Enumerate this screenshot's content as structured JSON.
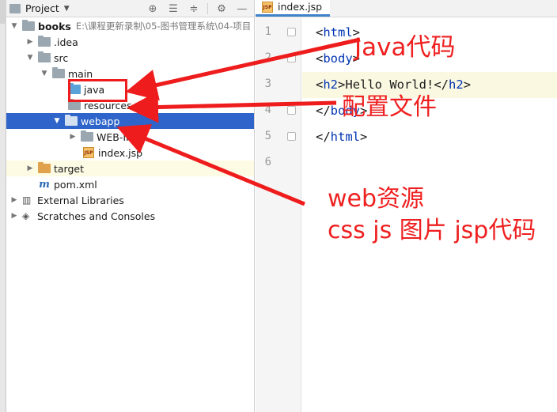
{
  "panel": {
    "title": "Project",
    "header_icons": [
      "target-icon",
      "collapse-all-icon",
      "expand-icon",
      "gear-icon",
      "minimize-icon"
    ]
  },
  "tree": [
    {
      "label": "books",
      "hint": "E:\\课程更新录制\\05-图书管理系统\\04-项目"
    },
    {
      "label": ".idea"
    },
    {
      "label": "src"
    },
    {
      "label": "main"
    },
    {
      "label": "java"
    },
    {
      "label": "resources"
    },
    {
      "label": "webapp"
    },
    {
      "label": "WEB-INF"
    },
    {
      "label": "index.jsp"
    },
    {
      "label": "target"
    },
    {
      "label": "pom.xml"
    },
    {
      "label": "External Libraries"
    },
    {
      "label": "Scratches and Consoles"
    }
  ],
  "editor": {
    "tab_label": "index.jsp",
    "current_line": 3,
    "lines": [
      {
        "no": "1",
        "text": ""
      },
      {
        "no": "2",
        "text": ""
      },
      {
        "no": "3",
        "text": ""
      },
      {
        "no": "4",
        "text": ""
      },
      {
        "no": "5",
        "text": ""
      },
      {
        "no": "6",
        "text": ""
      }
    ],
    "code": {
      "l1_tag": "html",
      "l2_tag": "body",
      "l3_open": "h2",
      "l3_text": "Hello World!",
      "l3_close": "h2",
      "l4_tag": "body",
      "l5_tag": "html"
    }
  },
  "annotations": {
    "java": "Java代码",
    "config": "配置文件",
    "web_line1": "web资源",
    "web_line2": "css js 图片 jsp代码",
    "color": "#ef1f1f"
  },
  "colors": {
    "selection": "#2f65ca",
    "tag": "#0033b3",
    "annotation": "#ef1f1f"
  }
}
